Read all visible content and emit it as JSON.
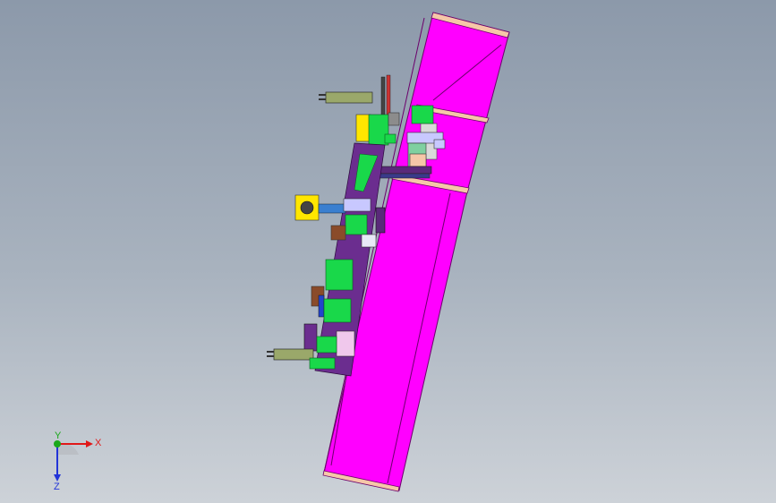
{
  "viewport": {
    "background_top": "#8c99aa",
    "background_bottom": "#cdd2d8"
  },
  "model": {
    "frame_color": "#ff00ff",
    "frame_edge_color": "#6b006b",
    "band_color": "#f6c7a8",
    "part_colors": {
      "green": "#19d84a",
      "purple": "#6b2d8f",
      "yellow": "#ffe600",
      "pale_pink": "#f0c8ec",
      "brown": "#8a4b2a",
      "blue": "#2244cc",
      "gray": "#8c8c8c",
      "olive": "#9aa86a"
    }
  },
  "triad": {
    "x_label": "X",
    "y_label": "Y",
    "z_label": "Z",
    "x_color": "#e01818",
    "y_color": "#1aa81a",
    "z_color": "#2234d8"
  }
}
